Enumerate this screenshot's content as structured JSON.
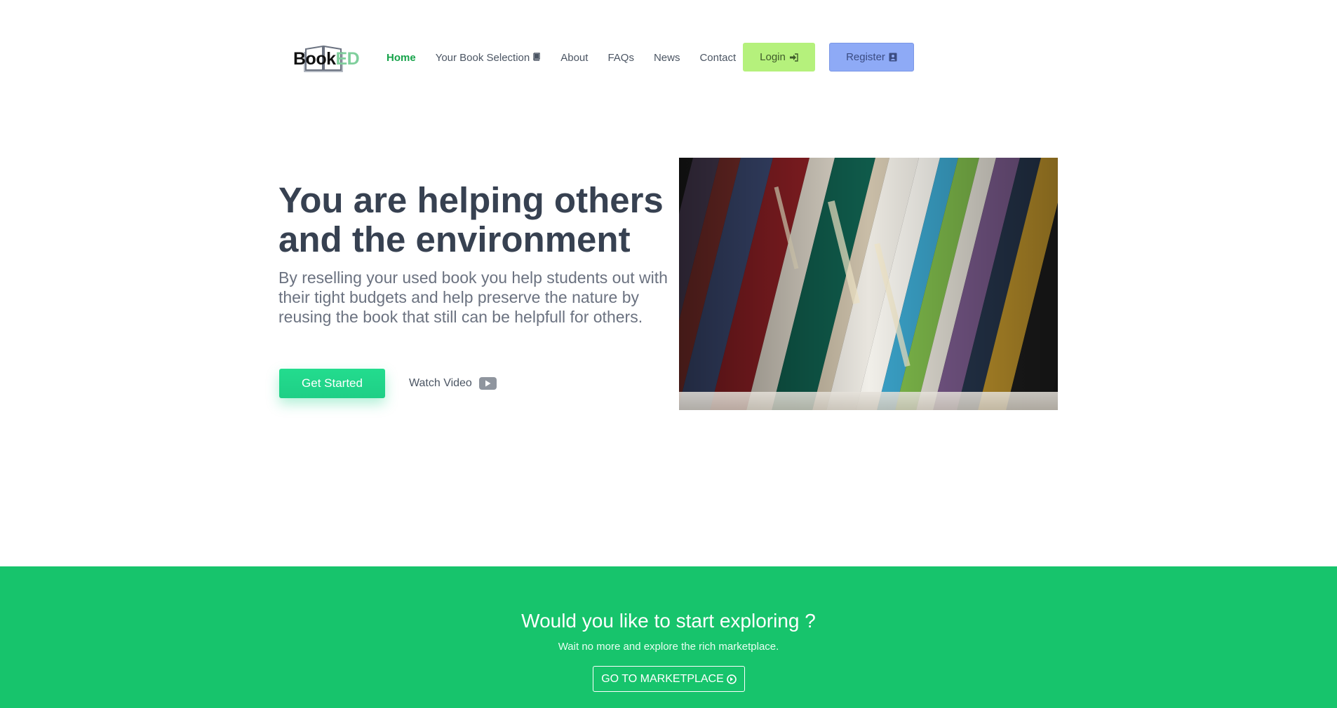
{
  "brand": {
    "part1": "Book",
    "part2": "ED"
  },
  "nav": {
    "items": [
      {
        "label": "Home",
        "active": true
      },
      {
        "label": "Your Book Selection",
        "icon": "book-icon"
      },
      {
        "label": "About"
      },
      {
        "label": "FAQs"
      },
      {
        "label": "News"
      },
      {
        "label": "Contact"
      }
    ],
    "login_label": "Login",
    "login_icon": "sign-in-icon",
    "register_label": "Register",
    "register_icon": "user-card-icon"
  },
  "hero": {
    "title": "You are helping others and the environment",
    "text": "By reselling your used book you help students out with their tight budgets and help preserve the nature by reusing the book that still can be helpfull for others.",
    "cta_label": "Get Started",
    "video_label": "Watch Video",
    "video_icon": "play-icon",
    "image": "bookshelf-photo"
  },
  "banner": {
    "title": "Would you like to start exploring ?",
    "subtitle": "Wait no more and explore the rich marketplace.",
    "button_label": "GO TO MARKETPLACE",
    "button_icon": "arrow-circle-right-icon"
  },
  "colors": {
    "accent_green": "#17c46c",
    "nav_active": "#16a34a",
    "login_bg": "#b5f17c",
    "register_bg": "#8eaaf6",
    "cta_button": "#23dc8e"
  }
}
